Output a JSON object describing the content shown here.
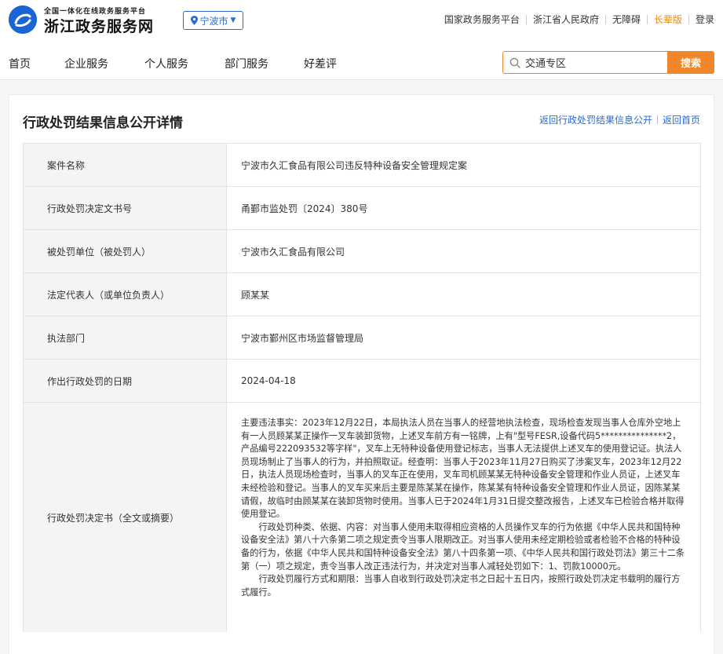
{
  "header": {
    "logo_subtitle": "全国一体化在线政务服务平台",
    "logo_title": "浙江政务服务网",
    "city": "宁波市",
    "top_links": [
      "国家政务服务平台",
      "浙江省人民政府",
      "无障碍",
      "长辈版",
      "登录"
    ]
  },
  "nav": {
    "items": [
      "首页",
      "企业服务",
      "个人服务",
      "部门服务",
      "好差评"
    ],
    "search_value": "交通专区",
    "search_button": "搜索"
  },
  "colors": {
    "brand_blue": "#2a6bd1",
    "accent_orange": "#f0862a"
  },
  "page": {
    "title": "行政处罚结果信息公开详情",
    "return_list": "返回行政处罚结果信息公开",
    "return_home": "返回首页"
  },
  "details": [
    {
      "label": "案件名称",
      "value": "宁波市久汇食品有限公司违反特种设备安全管理规定案"
    },
    {
      "label": "行政处罚决定文书号",
      "value": "甬鄞市监处罚〔2024〕380号"
    },
    {
      "label": "被处罚单位（被处罚人）",
      "value": "宁波市久汇食品有限公司"
    },
    {
      "label": "法定代表人（或单位负责人）",
      "value": "顾某某"
    },
    {
      "label": "执法部门",
      "value": "宁波市鄞州区市场监督管理局"
    },
    {
      "label": "作出行政处罚的日期",
      "value": "2024-04-18"
    }
  ],
  "decision": {
    "label": "行政处罚决定书（全文或摘要）",
    "paragraphs": [
      "主要违法事实：2023年12月22日，本局执法人员在当事人的经营地执法检查，现场检查发现当事人仓库外空地上有一人员顾某某正操作一叉车装卸货物，上述叉车前方有一铭牌，上有\"型号FESR,设备代码5***************2，产品编号222093532等字样\"，叉车上无特种设备使用登记标志，当事人无法提供上述叉车的使用登记证。执法人员现场制止了当事人的行为，并拍照取证。经查明：当事人于2023年11月27日购买了涉案叉车，2023年12月22日，执法人员现场检查时，当事人的叉车正在使用，叉车司机顾某某无特种设备安全管理和作业人员证，上述叉车未经检验和登记。当事人的叉车买来后主要是陈某某在操作，陈某某有特种设备安全管理和作业人员证，因陈某某请假，故临时由顾某某在装卸货物时使用。当事人已于2024年1月31日提交整改报告，上述叉车已检验合格并取得使用登记。",
      "行政处罚种类、依据、内容：对当事人使用未取得相应资格的人员操作叉车的行为依据《中华人民共和国特种设备安全法》第八十六条第二项之规定责令当事人限期改正。对当事人使用未经定期检验或者检验不合格的特种设备的行为，依据《中华人民共和国特种设备安全法》第八十四条第一项、《中华人民共和国行政处罚法》第三十二条第（一）项之规定，责令当事人改正违法行为，并决定对当事人减轻处罚如下：1、罚款10000元。",
      "行政处罚履行方式和期限：当事人自收到行政处罚决定书之日起十五日内，按照行政处罚决定书载明的履行方式履行。"
    ]
  }
}
